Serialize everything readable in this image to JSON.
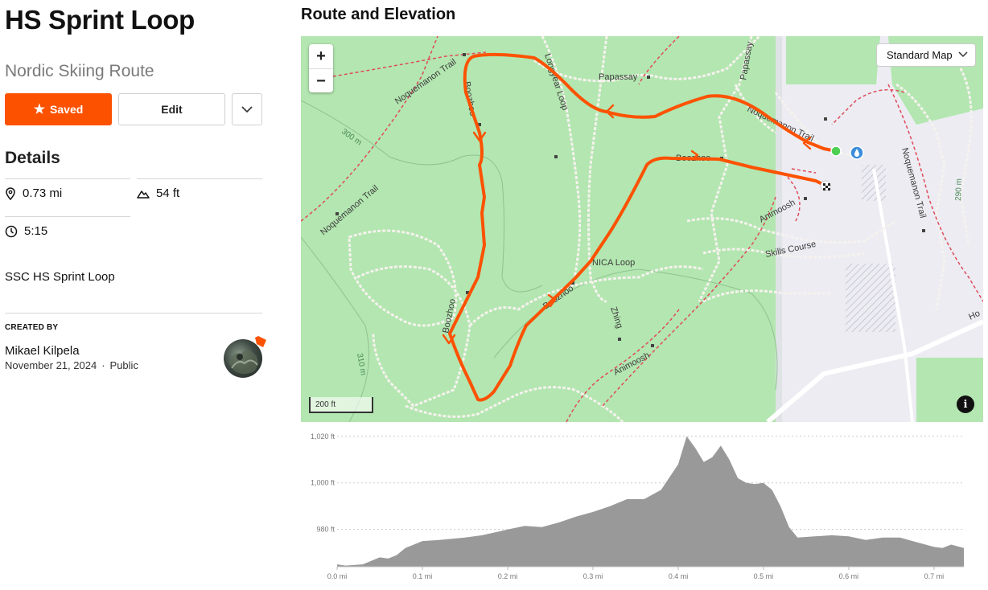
{
  "route": {
    "title": "HS Sprint Loop",
    "subtitle": "Nordic Skiing Route"
  },
  "actions": {
    "saved_label": "Saved",
    "edit_label": "Edit"
  },
  "details": {
    "heading": "Details",
    "distance": "0.73 mi",
    "elevation_gain": "54 ft",
    "estimated_time": "5:15",
    "description": "SSC HS Sprint Loop"
  },
  "creator": {
    "label": "CREATED BY",
    "name": "Mikael Kilpela",
    "date": "November 21, 2024",
    "separator": "·",
    "visibility": "Public"
  },
  "map": {
    "section_title": "Route and Elevation",
    "zoom_in": "+",
    "zoom_out": "−",
    "map_type": "Standard Map",
    "scale": "200 ft",
    "info": "i",
    "route_color": "#fc5200",
    "trail_labels": [
      "Noquemanon Trail",
      "Papassay",
      "Longyear Loop",
      "Boozhoo",
      "Boozhoo",
      "Boozhoo",
      "Boozhoo",
      "NICA Loop",
      "Zhing",
      "Animoosh",
      "Animoosh",
      "Skills Course",
      "Noquemanon Trail",
      "Noquemanon Trail",
      "Noquemanon Trail",
      "Papassay",
      "Ho"
    ],
    "contour_labels": [
      "300 m",
      "310 m",
      "290 m"
    ]
  },
  "chart_data": {
    "type": "area",
    "xlabel": "",
    "ylabel": "",
    "x_tick_labels": [
      "0.0 mi",
      "0.1 mi",
      "0.2 mi",
      "0.3 mi",
      "0.4 mi",
      "0.5 mi",
      "0.6 mi",
      "0.7 mi"
    ],
    "y_tick_labels": [
      "1,020 ft",
      "1,000 ft",
      "980 ft"
    ],
    "x_unit": "mi",
    "y_unit": "ft",
    "xlim": [
      0,
      0.735
    ],
    "ylim": [
      964,
      1022
    ],
    "grid": true,
    "color": "#999999",
    "series": [
      {
        "x": [
          0.0,
          0.01,
          0.03,
          0.05,
          0.06,
          0.07,
          0.08,
          0.1,
          0.12,
          0.15,
          0.17,
          0.2,
          0.22,
          0.24,
          0.26,
          0.28,
          0.3,
          0.32,
          0.34,
          0.36,
          0.38,
          0.4,
          0.41,
          0.42,
          0.43,
          0.44,
          0.45,
          0.46,
          0.47,
          0.48,
          0.49,
          0.5,
          0.51,
          0.52,
          0.53,
          0.54,
          0.56,
          0.58,
          0.6,
          0.62,
          0.64,
          0.66,
          0.68,
          0.7,
          0.71,
          0.72,
          0.735
        ],
        "y": [
          965,
          964.5,
          965,
          968,
          967.5,
          969,
          972,
          975,
          975.5,
          976.5,
          977.5,
          980,
          981.5,
          981,
          983,
          985.5,
          987.5,
          990,
          993,
          993,
          997,
          1008,
          1020,
          1015,
          1009,
          1011,
          1016,
          1010,
          1002,
          1000,
          999.5,
          1000,
          997,
          990,
          981,
          976.5,
          977,
          977.5,
          977,
          975.5,
          976.5,
          976.5,
          974.5,
          972.5,
          972,
          973.5,
          972
        ]
      }
    ]
  }
}
